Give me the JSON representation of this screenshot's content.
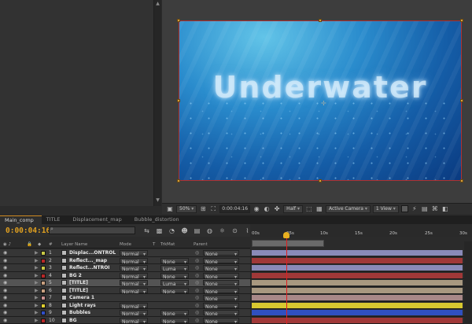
{
  "viewer": {
    "title_text": "Underwater",
    "zoom": "50%",
    "timecode": "0:00:04:16",
    "resolution": "Half",
    "camera": "Active Camera",
    "view": "1 View"
  },
  "tabs": [
    {
      "label": "Main_comp"
    },
    {
      "label": "TITLE"
    },
    {
      "label": "Displacement_map"
    },
    {
      "label": "Bubble_distortion"
    }
  ],
  "timeline": {
    "timecode": "0:00:04:16",
    "search_placeholder": "",
    "ruler": [
      "00s",
      "05s",
      "10s",
      "15s",
      "20s",
      "25s",
      "30s"
    ],
    "columns": {
      "layer_name": "Layer Name",
      "mode": "Mode",
      "t": "T",
      "trkmat": "TrkMat",
      "parent": "Parent"
    }
  },
  "layers": [
    {
      "num": "1",
      "name": "Displac...ONTROL",
      "label_color": "#c8c846",
      "mode": "Normal",
      "trkmat": "",
      "parent": "None",
      "bar_color": "#8a8ab8",
      "selected": false
    },
    {
      "num": "2",
      "name": "Reflect..._map",
      "label_color": "#b82828",
      "mode": "Normal",
      "trkmat": "None",
      "parent": "None",
      "bar_color": "#a03838",
      "selected": false
    },
    {
      "num": "3",
      "name": "Reflect...NTROI",
      "label_color": "#c8c846",
      "mode": "Normal",
      "trkmat": "Luma",
      "parent": "None",
      "bar_color": "#8a8ab8",
      "selected": false
    },
    {
      "num": "4",
      "name": "BG 2",
      "label_color": "#b82828",
      "mode": "Normal",
      "trkmat": "None",
      "parent": "None",
      "bar_color": "#a03838",
      "selected": false
    },
    {
      "num": "5",
      "name": "[TITLE]",
      "label_color": "#c8a080",
      "mode": "Normal",
      "trkmat": "Luma",
      "parent": "None",
      "bar_color": "#a89880",
      "selected": true
    },
    {
      "num": "6",
      "name": "[TITLE]",
      "label_color": "#c8a080",
      "mode": "Normal",
      "trkmat": "None",
      "parent": "None",
      "bar_color": "#a89880",
      "selected": false
    },
    {
      "num": "7",
      "name": "Camera 1",
      "label_color": "#c89090",
      "mode": "",
      "trkmat": "",
      "parent": "None",
      "bar_color": "#a88888",
      "selected": false
    },
    {
      "num": "8",
      "name": "Light rays",
      "label_color": "#e0d030",
      "mode": "Normal",
      "trkmat": "",
      "parent": "None",
      "bar_color": "#d8c830",
      "selected": false
    },
    {
      "num": "9",
      "name": "Bubbles",
      "label_color": "#3050c8",
      "mode": "Normal",
      "trkmat": "None",
      "parent": "None",
      "bar_color": "#3050c0",
      "selected": false
    },
    {
      "num": "10",
      "name": "BG",
      "label_color": "#b82828",
      "mode": "Normal",
      "trkmat": "None",
      "parent": "None",
      "bar_color": "#a03838",
      "selected": false
    }
  ]
}
